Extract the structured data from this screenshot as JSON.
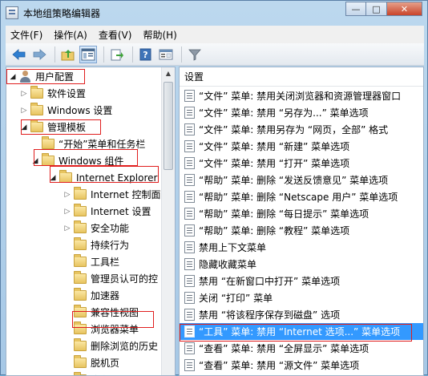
{
  "window": {
    "title": "本地组策略编辑器",
    "min_glyph": "—",
    "max_glyph": "□",
    "close_glyph": "✕"
  },
  "menu": [
    "文件(F)",
    "操作(A)",
    "查看(V)",
    "帮助(H)"
  ],
  "toolbar": [
    "back-icon",
    "forward-icon",
    "up-folder-icon",
    "show-hide-tree-icon",
    "export-list-icon",
    "help-icon",
    "properties-icon",
    "filter-icon"
  ],
  "tree": [
    {
      "label": "用户配置",
      "expander": "◢",
      "icon": "user",
      "highlight": true
    },
    {
      "label": "软件设置",
      "expander": "▷",
      "icon": "folder"
    },
    {
      "label": "Windows 设置",
      "expander": "▷",
      "icon": "folder"
    },
    {
      "label": "管理模板",
      "expander": "◢",
      "icon": "folder",
      "highlight": true
    },
    {
      "label": "“开始”菜单和任务栏",
      "expander": "",
      "icon": "folder"
    },
    {
      "label": "Windows 组件",
      "expander": "◢",
      "icon": "folder",
      "highlight": true
    },
    {
      "label": "Internet Explorer",
      "expander": "◢",
      "icon": "folder",
      "highlight": true
    },
    {
      "label": "Internet 控制面",
      "expander": "▷",
      "icon": "folder"
    },
    {
      "label": "Internet 设置",
      "expander": "▷",
      "icon": "folder"
    },
    {
      "label": "安全功能",
      "expander": "▷",
      "icon": "folder"
    },
    {
      "label": "持续行为",
      "expander": "",
      "icon": "folder"
    },
    {
      "label": "工具栏",
      "expander": "",
      "icon": "folder"
    },
    {
      "label": "管理员认可的控",
      "expander": "",
      "icon": "folder"
    },
    {
      "label": "加速器",
      "expander": "",
      "icon": "folder"
    },
    {
      "label": "兼容性视图",
      "expander": "",
      "icon": "folder"
    },
    {
      "label": "浏览器菜单",
      "expander": "",
      "icon": "folder",
      "highlight": true
    },
    {
      "label": "删除浏览的历史",
      "expander": "",
      "icon": "folder"
    },
    {
      "label": "脱机页",
      "expander": "",
      "icon": "folder"
    },
    {
      "label": "隐私",
      "expander": "",
      "icon": "folder"
    }
  ],
  "list": {
    "header": "设置",
    "items": [
      {
        "label": "“文件” 菜单: 禁用关闭浏览器和资源管理器窗口"
      },
      {
        "label": "“文件” 菜单: 禁用 “另存为...” 菜单选项"
      },
      {
        "label": "“文件” 菜单: 禁用另存为 “网页，全部” 格式"
      },
      {
        "label": "“文件” 菜单: 禁用 “新建” 菜单选项"
      },
      {
        "label": "“文件” 菜单: 禁用 “打开” 菜单选项"
      },
      {
        "label": "“帮助” 菜单: 删除 “发送反馈意见” 菜单选项"
      },
      {
        "label": "“帮助” 菜单: 删除 “Netscape 用户” 菜单选项"
      },
      {
        "label": "“帮助” 菜单: 删除 “每日提示” 菜单选项"
      },
      {
        "label": "“帮助” 菜单: 删除 “教程” 菜单选项"
      },
      {
        "label": "禁用上下文菜单"
      },
      {
        "label": "隐藏收藏菜单"
      },
      {
        "label": "禁用 “在新窗口中打开” 菜单选项"
      },
      {
        "label": "关闭 “打印” 菜单"
      },
      {
        "label": "禁用 “将该程序保存到磁盘” 选项"
      },
      {
        "label": "“工具” 菜单: 禁用 “Internet 选项...” 菜单选项",
        "selected": true,
        "highlight": true
      },
      {
        "label": "“查看” 菜单: 禁用 “全屏显示” 菜单选项"
      },
      {
        "label": "“查看” 菜单: 禁用 “源文件” 菜单选项"
      }
    ]
  },
  "colors": {
    "selection": "#3399ff",
    "highlight_border": "#e01e1e"
  }
}
